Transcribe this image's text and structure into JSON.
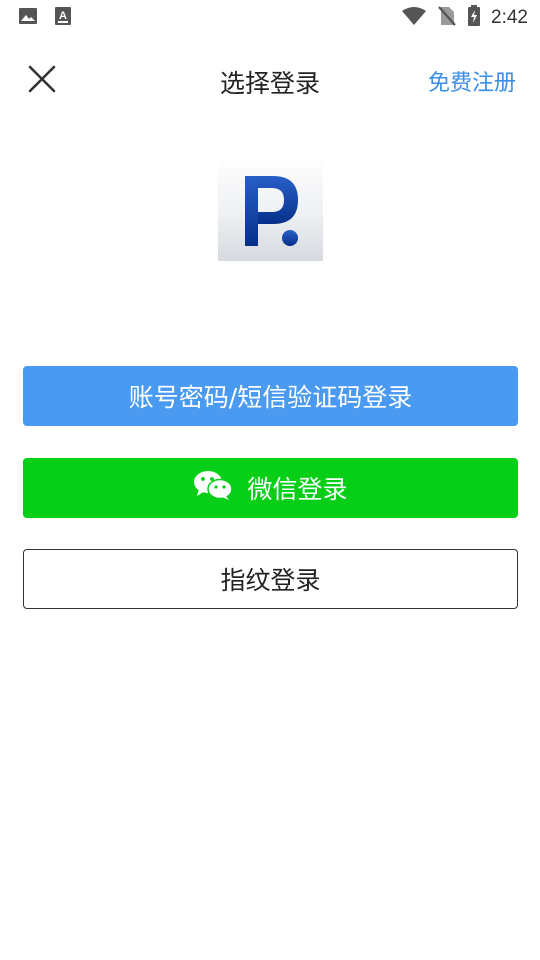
{
  "status_bar": {
    "time": "2:42",
    "icons": [
      "image-icon",
      "keyboard-a-icon",
      "wifi-icon",
      "no-sim-icon",
      "battery-charging-icon"
    ]
  },
  "nav": {
    "title": "选择登录",
    "register_label": "免费注册",
    "close_icon": "close-icon"
  },
  "logo": {
    "letter": "P",
    "color": "#0a3fa6"
  },
  "buttons": {
    "account_login": "账号密码/短信验证码登录",
    "wechat_login": "微信登录",
    "fingerprint_login": "指纹登录"
  },
  "colors": {
    "accent_blue": "#4a9af2",
    "link_blue": "#3a8ee6",
    "wechat_green": "#07cf18"
  }
}
